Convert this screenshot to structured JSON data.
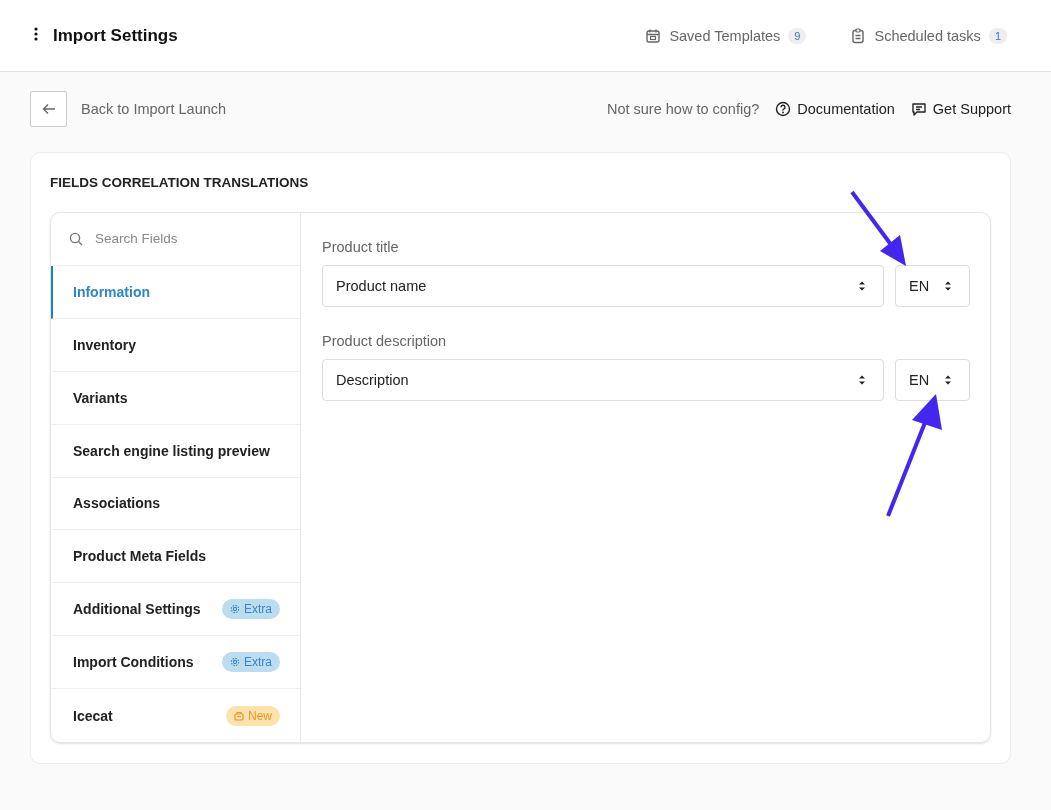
{
  "header": {
    "title": "Import Settings",
    "links": [
      {
        "kind": "templates",
        "label": "Saved Templates",
        "count": "9"
      },
      {
        "kind": "tasks",
        "label": "Scheduled tasks",
        "count": "1"
      }
    ]
  },
  "toolbar": {
    "back_label": "Back to Import Launch",
    "help_text": "Not sure how to config?",
    "links": [
      {
        "kind": "docs",
        "label": "Documentation"
      },
      {
        "kind": "support",
        "label": "Get Support"
      }
    ]
  },
  "card": {
    "title": "FIELDS CORRELATION TRANSLATIONS",
    "search": {
      "placeholder": "Search Fields"
    },
    "sidebar": {
      "items": [
        {
          "label": "Information",
          "selected": true
        },
        {
          "label": "Inventory",
          "selected": false
        },
        {
          "label": "Variants",
          "selected": false
        },
        {
          "label": "Search engine listing preview",
          "selected": false
        },
        {
          "label": "Associations",
          "selected": false
        },
        {
          "label": "Product Meta Fields",
          "selected": false
        },
        {
          "label": "Additional Settings",
          "selected": false,
          "badge": {
            "kind": "extra",
            "label": "Extra"
          }
        },
        {
          "label": "Import Conditions",
          "selected": false,
          "badge": {
            "kind": "extra",
            "label": "Extra"
          }
        },
        {
          "label": "Icecat",
          "selected": false,
          "badge": {
            "kind": "new",
            "label": "New"
          }
        }
      ]
    },
    "fields": [
      {
        "label": "Product title",
        "value": "Product name",
        "language": "EN"
      },
      {
        "label": "Product description",
        "value": "Description",
        "language": "EN"
      }
    ]
  }
}
